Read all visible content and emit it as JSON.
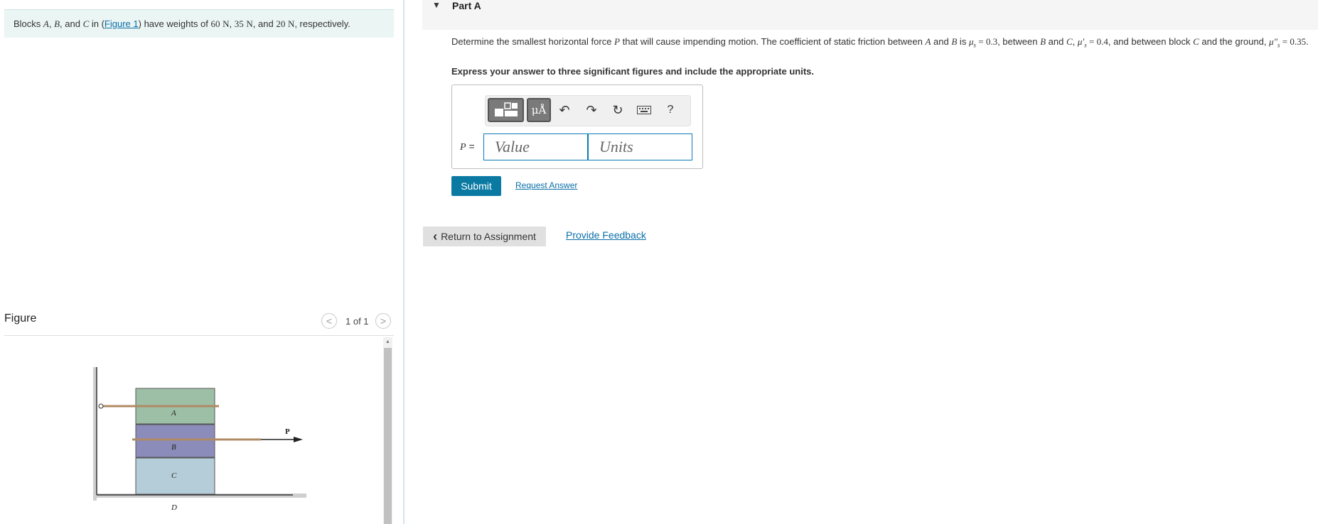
{
  "problem": {
    "prefix": "Blocks ",
    "block_a": "A",
    "comma1": ", ",
    "block_b": "B",
    "and": ", and ",
    "block_c": "C",
    "in_paren": " in (",
    "figure_link": "Figure 1",
    "have_weights": ") have weights of ",
    "w1": "60",
    "unit1": "N",
    "sep1": ", ",
    "w2": "35",
    "unit2": "N",
    "sep2": ", and ",
    "w3": "20",
    "unit3": "N",
    "suffix": ", respectively."
  },
  "figure": {
    "title": "Figure",
    "pager": "1 of 1",
    "prev_icon": "<",
    "next_icon": ">",
    "labels": {
      "a": "A",
      "b": "B",
      "c": "C",
      "d": "D",
      "p": "P"
    },
    "colors": {
      "block_a": "#9dbfa6",
      "block_b": "#8b8cba",
      "block_c": "#b5ccd9",
      "cord": "#b08a64"
    }
  },
  "part_a": {
    "title": "Part A",
    "question": {
      "t1": "Determine the smallest horizontal force ",
      "p": "P",
      "t2": " that will cause impending motion. The coefficient of static friction between ",
      "a": "A",
      "t3": " and ",
      "b": "B",
      "t4": " is ",
      "mu1": "μ",
      "mu1_sub": "s",
      "eq1": " = 0.3",
      "t5": ", between ",
      "b2": "B",
      "t6": " and ",
      "c": "C",
      "t7": ", ",
      "mu2": "μ′",
      "mu2_sub": "s",
      "eq2": " = 0.4",
      "t8": ", and between block ",
      "c2": "C",
      "t9": " and the ground, ",
      "mu3": "μ″",
      "mu3_sub": "s",
      "eq3": " = 0.35",
      "t10": "."
    },
    "instruction": "Express your answer to three significant figures and include the appropriate units.",
    "answer": {
      "label": "P",
      "equals": " =",
      "value_placeholder": "Value",
      "units_placeholder": "Units"
    },
    "toolbar": {
      "templates_icon": "templates-icon",
      "symbols_label": "μÅ",
      "undo_icon": "↶",
      "redo_icon": "↷",
      "reset_icon": "↻",
      "keyboard_icon": "keyboard-icon",
      "help_label": "?"
    },
    "submit_label": "Submit",
    "request_answer_label": "Request Answer"
  },
  "footer": {
    "return_label": "Return to Assignment",
    "return_icon": "‹",
    "feedback_label": "Provide Feedback"
  }
}
